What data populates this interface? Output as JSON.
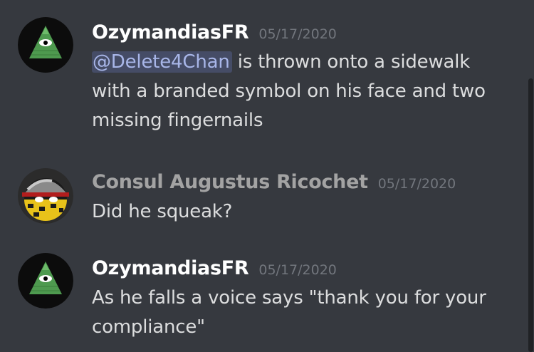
{
  "colors": {
    "background": "#36393f",
    "text": "#dcddde",
    "timestamp": "#72767d",
    "mention_bg": "#45496b",
    "mention_text": "#a8b6e8",
    "username_ozymandias": "#ffffff",
    "username_consul": "#a3a3a3"
  },
  "messages": [
    {
      "username": "OzymandiasFR",
      "timestamp": "05/17/2020",
      "avatar_icon": "illuminati-eye-pyramid-icon",
      "mention": "@Delete4Chan",
      "text": " is thrown onto a sidewalk with a branded symbol on his face and two missing fingernails"
    },
    {
      "username": "Consul Augustus Ricochet",
      "timestamp": "05/17/2020",
      "avatar_icon": "helmeted-countryball-icon",
      "text": "Did he squeak?"
    },
    {
      "username": "OzymandiasFR",
      "timestamp": "05/17/2020",
      "avatar_icon": "illuminati-eye-pyramid-icon",
      "text": "As he falls a voice says \"thank you for your compliance\""
    }
  ]
}
